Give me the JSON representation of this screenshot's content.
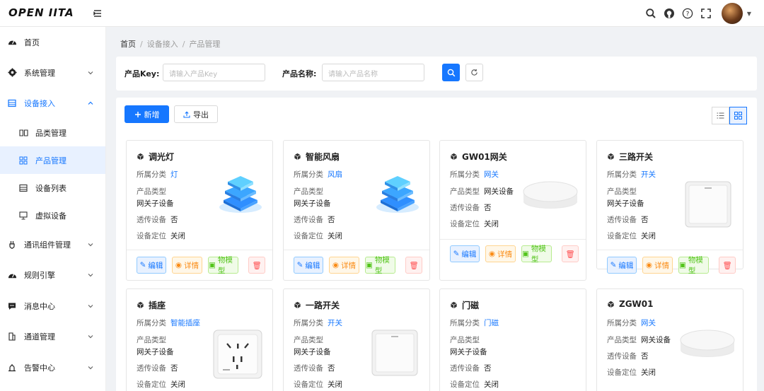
{
  "app": {
    "logo": "OPEN IITA"
  },
  "sidebar": {
    "items": [
      {
        "label": "首页",
        "icon": "dashboard-icon"
      },
      {
        "label": "系统管理",
        "icon": "gear-icon"
      },
      {
        "label": "设备接入",
        "icon": "device-icon"
      },
      {
        "label": "通讯组件管理",
        "icon": "plug-icon"
      },
      {
        "label": "规则引擎",
        "icon": "rule-icon"
      },
      {
        "label": "消息中心",
        "icon": "message-icon"
      },
      {
        "label": "通道管理",
        "icon": "channel-icon"
      },
      {
        "label": "告警中心",
        "icon": "alarm-icon"
      }
    ],
    "sub_items": [
      {
        "label": "品类管理",
        "icon": "book-icon"
      },
      {
        "label": "产品管理",
        "icon": "grid-icon"
      },
      {
        "label": "设备列表",
        "icon": "list-icon"
      },
      {
        "label": "虚拟设备",
        "icon": "monitor-icon"
      }
    ]
  },
  "breadcrumb": {
    "home": "首页",
    "level2": "设备接入",
    "current": "产品管理",
    "separator": "/"
  },
  "search": {
    "key_label": "产品Key:",
    "key_placeholder": "请输入产品Key",
    "name_label": "产品名称:",
    "name_placeholder": "请输入产品名称"
  },
  "toolbar": {
    "add_label": "新增",
    "export_label": "导出"
  },
  "card_labels": {
    "category": "所属分类",
    "product_type": "产品类型",
    "transparent": "透传设备",
    "location": "设备定位",
    "edit": "编辑",
    "detail": "详情",
    "model": "物模型"
  },
  "products": [
    {
      "name": "调光灯",
      "category": "灯",
      "type": "网关子设备",
      "transparent": "否",
      "location": "关闭",
      "image": "cube-device"
    },
    {
      "name": "智能风扇",
      "category": "风扇",
      "type": "网关子设备",
      "transparent": "否",
      "location": "关闭",
      "image": "cube-device"
    },
    {
      "name": "GW01网关",
      "category": "网关",
      "type": "网关设备",
      "transparent": "否",
      "location": "关闭",
      "image": "gateway-disc"
    },
    {
      "name": "三路开关",
      "category": "开关",
      "type": "网关子设备",
      "transparent": "否",
      "location": "关闭",
      "image": "wall-switch"
    },
    {
      "name": "插座",
      "category": "智能插座",
      "type": "网关子设备",
      "transparent": "否",
      "location": "关闭",
      "image": "wall-socket"
    },
    {
      "name": "一路开关",
      "category": "开关",
      "type": "网关子设备",
      "transparent": "否",
      "location": "关闭",
      "image": "wall-switch"
    },
    {
      "name": "门磁",
      "category": "门磁",
      "type": "网关子设备",
      "transparent": "否",
      "location": "关闭",
      "image": "none"
    },
    {
      "name": "ZGW01",
      "category": "网关",
      "type": "网关设备",
      "transparent": "否",
      "location": "关闭",
      "image": "gateway-disc"
    }
  ],
  "colors": {
    "primary": "#1677ff",
    "detail": "#fa8c16",
    "model": "#52c41a",
    "danger": "#ff4d4f"
  }
}
